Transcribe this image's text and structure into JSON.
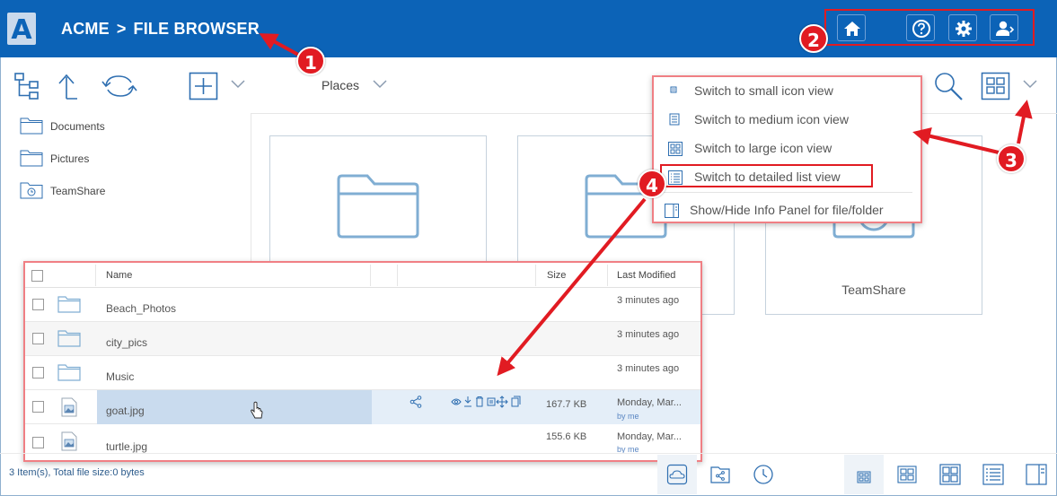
{
  "header": {
    "logo_letter": "A",
    "brand": "ACME",
    "separator": ">",
    "section": "FILE BROWSER",
    "buttons": [
      "home-icon",
      "help-icon",
      "gear-icon",
      "user-logout-icon"
    ]
  },
  "annotations": [
    "1",
    "2",
    "3",
    "4"
  ],
  "toolbar": {
    "places_label": "Places",
    "left_icons": [
      "tree-icon",
      "up-arrow-icon",
      "refresh-icon",
      "add-icon",
      "chevron-down-icon"
    ],
    "right_icons": [
      "search-icon",
      "grid-view-icon",
      "chevron-down-icon"
    ]
  },
  "sidebar": {
    "items": [
      {
        "label": "Documents",
        "icon": "folder-icon"
      },
      {
        "label": "Pictures",
        "icon": "folder-icon"
      },
      {
        "label": "TeamShare",
        "icon": "teamshare-folder-icon"
      }
    ]
  },
  "tiles": [
    {
      "label": "",
      "icon": "folder-icon"
    },
    {
      "label": "",
      "icon": "folder-icon"
    },
    {
      "label": "TeamShare",
      "icon": "teamshare-folder-icon"
    }
  ],
  "view_menu": {
    "items": [
      {
        "label": "Switch to small icon view",
        "icon": "small-icon-view-icon"
      },
      {
        "label": "Switch to medium icon view",
        "icon": "medium-icon-view-icon"
      },
      {
        "label": "Switch to large icon view",
        "icon": "large-icon-view-icon"
      },
      {
        "label": "Switch to detailed list view",
        "icon": "detailed-list-view-icon"
      },
      {
        "label": "Show/Hide Info Panel for file/folder",
        "icon": "info-panel-icon"
      }
    ]
  },
  "file_list": {
    "columns": {
      "name": "Name",
      "size": "Size",
      "modified": "Last Modified"
    },
    "rows": [
      {
        "name": "Beach_Photos",
        "type": "folder",
        "size": "",
        "modified": "3 minutes ago",
        "by": ""
      },
      {
        "name": "city_pics",
        "type": "folder",
        "size": "",
        "modified": "3 minutes ago",
        "by": ""
      },
      {
        "name": "Music",
        "type": "folder",
        "size": "",
        "modified": "3 minutes ago",
        "by": ""
      },
      {
        "name": "goat.jpg",
        "type": "image",
        "size": "167.7 KB",
        "modified": "Monday, Mar...",
        "by": "by me"
      },
      {
        "name": "turtle.jpg",
        "type": "image",
        "size": "155.6 KB",
        "modified": "Monday, Mar...",
        "by": "by me"
      }
    ],
    "row_actions": [
      "share-icon",
      "view-icon",
      "download-icon",
      "delete-icon",
      "rename-icon",
      "move-icon",
      "copy-icon"
    ]
  },
  "status": {
    "text": "3 Item(s), Total file size:0 bytes"
  },
  "footer": {
    "buttons": [
      "cloud-icon",
      "shared-icon",
      "recent-icon",
      "small-view-icon",
      "medium-view-icon",
      "large-view-icon",
      "list-view-icon",
      "panel-icon"
    ]
  },
  "colors": {
    "header_bg": "#0c63b7",
    "annotation_red": "#e11b22",
    "icon_blue": "#2f6fb1"
  }
}
